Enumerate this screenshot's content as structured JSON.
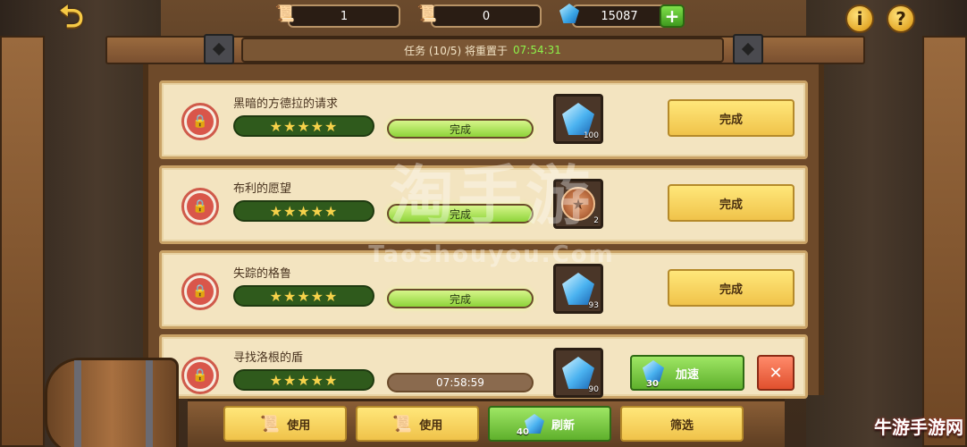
{
  "header": {
    "back_icon": "back-arrow-icon",
    "scroll_blue_count": "1",
    "scroll_purple_count": "0",
    "gem_count": "15087",
    "plus_label": "+",
    "info_label": "i",
    "help_label": "?",
    "reset_label": "任务 (10/5) 将重置于",
    "reset_time": "07:54:31"
  },
  "quests": [
    {
      "title": "黑暗的方德拉的请求",
      "stars": "★★★★★",
      "status": "完成",
      "reward_type": "gem",
      "reward_count": "100",
      "action": "完成"
    },
    {
      "title": "布利的愿望",
      "stars": "★★★★★",
      "status": "完成",
      "reward_type": "medal",
      "reward_count": "2",
      "action": "完成"
    },
    {
      "title": "失踪的格鲁",
      "stars": "★★★★★",
      "status": "完成",
      "reward_type": "gem",
      "reward_count": "93",
      "action": "完成"
    },
    {
      "title": "寻找洛根的盾",
      "stars": "★★★★★",
      "status": "07:58:59",
      "reward_type": "gem",
      "reward_count": "90",
      "speed_label": "加速",
      "speed_cost": "30",
      "cancel_label": "✕"
    }
  ],
  "bottom": {
    "use_blue_label": "使用",
    "use_purple_label": "使用",
    "refresh_label": "刷新",
    "refresh_cost": "40",
    "filter_label": "筛选"
  },
  "watermark": {
    "main": "淘手游",
    "sub": "Taoshouyou.Com",
    "corner": "牛游手游网"
  },
  "colors": {
    "done_bar": "#8ed43a",
    "complete_button": "#f0c34a",
    "speed_button": "#5fb02c",
    "cancel_button": "#e0502e",
    "timer_green": "#8df24a"
  }
}
